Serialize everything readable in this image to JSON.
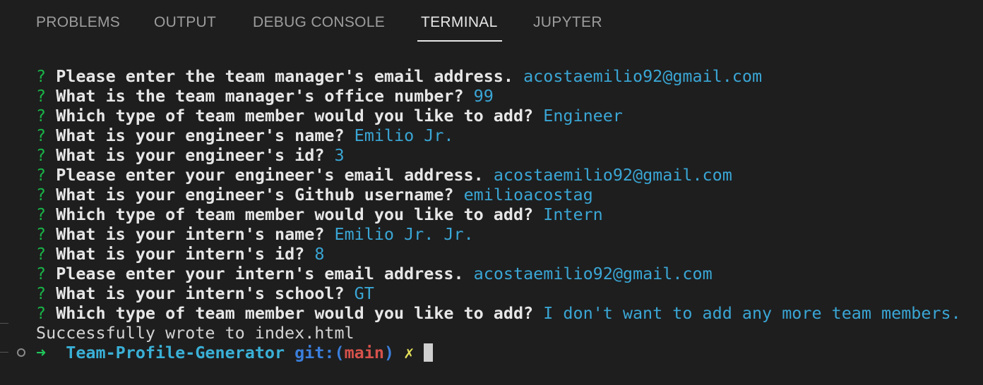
{
  "tabs": [
    {
      "label": "PROBLEMS",
      "active": false
    },
    {
      "label": "OUTPUT",
      "active": false
    },
    {
      "label": "DEBUG CONSOLE",
      "active": false
    },
    {
      "label": "TERMINAL",
      "active": true
    },
    {
      "label": "JUPYTER",
      "active": false
    }
  ],
  "terminal": {
    "qmark": "?",
    "lines": [
      {
        "prompt": "Please enter the team manager's email address.",
        "answer": "acostaemilio92@gmail.com"
      },
      {
        "prompt": "What is the team manager's office number?",
        "answer": "99"
      },
      {
        "prompt": "Which type of team member would you like to add?",
        "answer": "Engineer"
      },
      {
        "prompt": "What is your engineer's name?",
        "answer": "Emilio Jr."
      },
      {
        "prompt": "What is your engineer's id?",
        "answer": "3"
      },
      {
        "prompt": "Please enter your engineer's email address.",
        "answer": "acostaemilio92@gmail.com"
      },
      {
        "prompt": "What is your engineer's Github username?",
        "answer": "emilioacostag"
      },
      {
        "prompt": "Which type of team member would you like to add?",
        "answer": "Intern"
      },
      {
        "prompt": "What is your intern's name?",
        "answer": "Emilio Jr. Jr."
      },
      {
        "prompt": "What is your intern's id?",
        "answer": "8"
      },
      {
        "prompt": "Please enter your intern's email address.",
        "answer": "acostaemilio92@gmail.com"
      },
      {
        "prompt": "What is your intern's school?",
        "answer": "GT"
      },
      {
        "prompt": "Which type of team member would you like to add?",
        "answer": "I don't want to add any more team members."
      }
    ],
    "output": "Successfully wrote to index.html",
    "shell": {
      "arrow": "➜",
      "directory": "Team-Profile-Generator",
      "git_prefix": "git:(",
      "branch": "main",
      "git_suffix": ")",
      "dirty_mark": "✗"
    }
  },
  "colors": {
    "background": "#1e1e1e",
    "question_mark": "#19b347",
    "answer": "#3aa6d5",
    "branch": "#d6524b",
    "dirty": "#e5e05a"
  }
}
